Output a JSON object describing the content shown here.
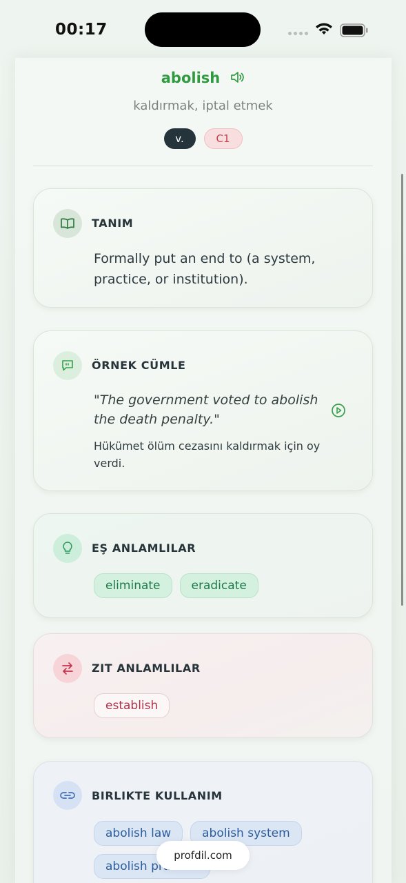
{
  "status_bar": {
    "time": "00:17",
    "icons": [
      "cellular-signal-icon",
      "wifi-icon",
      "battery-icon"
    ]
  },
  "word": {
    "title": "abolish",
    "translation": "kaldırmak, iptal etmek",
    "part_of_speech": "v.",
    "level": "C1",
    "speaker_icon": "speaker-icon"
  },
  "colors": {
    "accent_green": "#2f9a3f",
    "dark_tag": "#25343b",
    "level_red": "#c33f4a",
    "synonym_green": "#1f7a4a",
    "antonym_red": "#b0304a",
    "collocation_blue": "#2c5c9a"
  },
  "definition": {
    "title": "TANIM",
    "icon": "book-icon",
    "text": "Formally put an end to (a system, practice, or institution)."
  },
  "example": {
    "title": "ÖRNEK CÜMLE",
    "icon": "quote-bubble-icon",
    "sentence": "\"The government voted to abolish the death penalty.\"",
    "translation": "Hükümet ölüm cezasını kaldırmak için oy verdi.",
    "play_icon": "play-icon"
  },
  "synonyms": {
    "title": "EŞ ANLAMLILAR",
    "icon": "lightbulb-icon",
    "items": [
      "eliminate",
      "eradicate"
    ]
  },
  "antonyms": {
    "title": "ZIT ANLAMLILAR",
    "icon": "swap-arrows-icon",
    "items": [
      "establish"
    ]
  },
  "collocations": {
    "title": "BIRLIKTE KULLANIM",
    "icon": "link-icon",
    "items": [
      "abolish law",
      "abolish system",
      "abolish practice"
    ]
  },
  "toast": {
    "text": "profdil.com"
  }
}
